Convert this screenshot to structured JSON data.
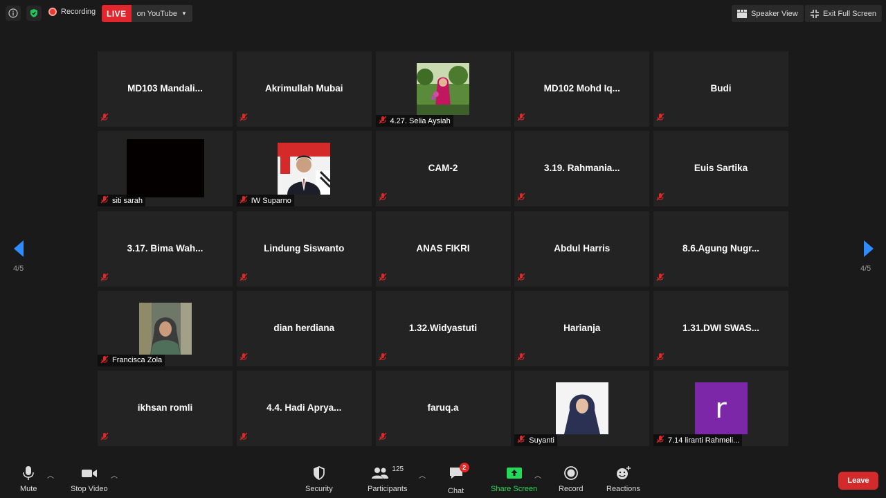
{
  "topbar": {
    "recording_label": "Recording",
    "live_label": "LIVE",
    "live_target": "on YouTube",
    "speaker_view_label": "Speaker View",
    "exit_fullscreen_label": "Exit Full Screen"
  },
  "pagination": {
    "left": "4/5",
    "right": "4/5"
  },
  "tiles": [
    {
      "name": "MD103  Mandali...",
      "kind": "name"
    },
    {
      "name": "Akrimullah Mubai",
      "kind": "name"
    },
    {
      "label": "4.27. Selia Aysiah",
      "kind": "photo",
      "photo": "garden-woman"
    },
    {
      "name": "MD102  Mohd  Iq...",
      "kind": "name"
    },
    {
      "name": "Budi",
      "kind": "name"
    },
    {
      "label": "siti sarah",
      "kind": "video-black"
    },
    {
      "label": "IW Suparno",
      "kind": "photo",
      "photo": "man-suit"
    },
    {
      "name": "CAM-2",
      "kind": "name"
    },
    {
      "name": "3.19.  Rahmania...",
      "kind": "name"
    },
    {
      "name": "Euis Sartika",
      "kind": "name"
    },
    {
      "name": "3.17.  Bima Wah...",
      "kind": "name"
    },
    {
      "name": "Lindung Siswanto",
      "kind": "name"
    },
    {
      "name": "ANAS FIKRI",
      "kind": "name"
    },
    {
      "name": "Abdul Harris",
      "kind": "name"
    },
    {
      "name": "8.6.Agung  Nugr...",
      "kind": "name"
    },
    {
      "label": "Francisca Zola",
      "kind": "photo",
      "photo": "woman-hijab"
    },
    {
      "name": "dian herdiana",
      "kind": "name"
    },
    {
      "name": "1.32.Widyastuti",
      "kind": "name"
    },
    {
      "name": "Harianja",
      "kind": "name"
    },
    {
      "name": "1.31.DWI  SWAS...",
      "kind": "name"
    },
    {
      "name": "ikhsan romli",
      "kind": "name"
    },
    {
      "name": "4.4.  Hadi Aprya...",
      "kind": "name"
    },
    {
      "name": "faruq.a",
      "kind": "name"
    },
    {
      "label": "Suyanti",
      "kind": "photo",
      "photo": "woman-navy"
    },
    {
      "label": "7.14 liranti Rahmeli...",
      "kind": "avatar",
      "letter": "r",
      "avatar_color": "#7c26a8"
    }
  ],
  "bottombar": {
    "mute": "Mute",
    "stop_video": "Stop Video",
    "security": "Security",
    "participants": "Participants",
    "participants_count": "125",
    "chat": "Chat",
    "chat_badge": "2",
    "share_screen": "Share Screen",
    "record": "Record",
    "reactions": "Reactions",
    "leave": "Leave"
  },
  "colors": {
    "share_green": "#23d959",
    "live_red": "#e0272e",
    "leave_red": "#d32b2b",
    "arrow_blue": "#2d8cff"
  }
}
